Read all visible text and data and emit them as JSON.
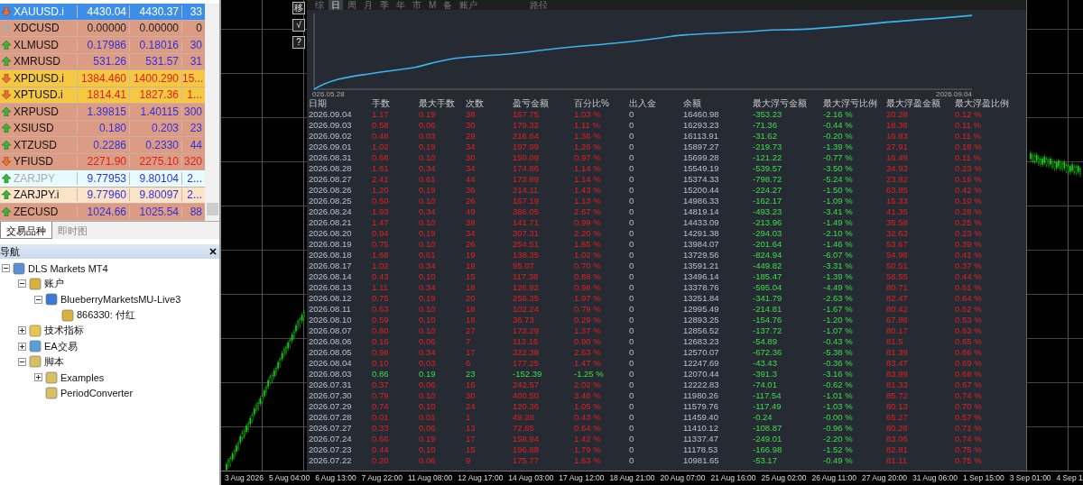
{
  "market_watch": {
    "rows": [
      {
        "symbol": "XAUUSD.i",
        "bid": "4430.04",
        "ask": "4430.37",
        "spread": "33",
        "kind": "down",
        "selected": true,
        "disabled": false
      },
      {
        "symbol": "XDCUSD",
        "bid": "0.00000",
        "ask": "0.00000",
        "spread": "0",
        "kind": "flat",
        "color": "#dc9c84",
        "selected": false,
        "disabled": false
      },
      {
        "symbol": "XLMUSD",
        "bid": "0.17986",
        "ask": "0.18016",
        "spread": "30",
        "kind": "up",
        "color": "#dc9c84",
        "selected": false,
        "disabled": false
      },
      {
        "symbol": "XMRUSD",
        "bid": "531.26",
        "ask": "531.57",
        "spread": "31",
        "kind": "up",
        "color": "#dc9c84",
        "selected": false,
        "disabled": false
      },
      {
        "symbol": "XPDUSD.i",
        "bid": "1384.460",
        "ask": "1400.290",
        "spread": "15...",
        "kind": "down",
        "color": "#f5c842",
        "selected": false,
        "disabled": false
      },
      {
        "symbol": "XPTUSD.i",
        "bid": "1814.41",
        "ask": "1827.36",
        "spread": "1...",
        "kind": "down",
        "color": "#f5c842",
        "selected": false,
        "disabled": false
      },
      {
        "symbol": "XRPUSD",
        "bid": "1.39815",
        "ask": "1.40115",
        "spread": "300",
        "kind": "up",
        "color": "#dc9c84",
        "selected": false,
        "disabled": false
      },
      {
        "symbol": "XSIUSD",
        "bid": "0.180",
        "ask": "0.203",
        "spread": "23",
        "kind": "up",
        "color": "#dc9c84",
        "selected": false,
        "disabled": false
      },
      {
        "symbol": "XTZUSD",
        "bid": "0.2286",
        "ask": "0.2330",
        "spread": "44",
        "kind": "up",
        "color": "#dc9c84",
        "selected": false,
        "disabled": false
      },
      {
        "symbol": "YFIUSD",
        "bid": "2271.90",
        "ask": "2275.10",
        "spread": "320",
        "kind": "down",
        "color": "#dc9c84",
        "selected": false,
        "disabled": false
      },
      {
        "symbol": "ZARJPY",
        "bid": "9.77953",
        "ask": "9.80104",
        "spread": "2...",
        "kind": "up",
        "color": "#e6fbfd",
        "selected": false,
        "disabled": true
      },
      {
        "symbol": "ZARJPY.i",
        "bid": "9.77960",
        "ask": "9.80097",
        "spread": "2...",
        "kind": "up",
        "color": "#fbe3c8",
        "selected": false,
        "disabled": false
      },
      {
        "symbol": "ZECUSD",
        "bid": "1024.66",
        "ask": "1025.54",
        "spread": "88",
        "kind": "up",
        "color": "#dc9c84",
        "selected": false,
        "disabled": false
      }
    ]
  },
  "bottom_tabs": [
    {
      "label": "交易品种",
      "selected": true
    },
    {
      "label": "即时图",
      "selected": false
    }
  ],
  "navigator": {
    "title": "导航",
    "tree": [
      {
        "label": "DLS Markets MT4",
        "kind": "terminal",
        "expanded": true,
        "children": [
          {
            "label": "账户",
            "kind": "accounts",
            "expanded": true,
            "children": [
              {
                "label": "BlueberryMarketsMU-Live3",
                "kind": "server",
                "expanded": true,
                "children": [
                  {
                    "label": "866330: 付红",
                    "kind": "user"
                  }
                ]
              }
            ]
          },
          {
            "label": "技术指标",
            "kind": "indicator",
            "expanded": false
          },
          {
            "label": "EA交易",
            "kind": "expert",
            "expanded": false
          },
          {
            "label": "脚本",
            "kind": "script",
            "expanded": true,
            "children": [
              {
                "label": "Examples",
                "kind": "script",
                "expanded": false
              },
              {
                "label": "PeriodConverter",
                "kind": "script"
              }
            ]
          }
        ]
      }
    ]
  },
  "report": {
    "side_buttons": [
      "移",
      "√",
      "?"
    ],
    "tabs": [
      {
        "label": "综",
        "selected": false
      },
      {
        "label": "日",
        "selected": true
      },
      {
        "label": "周",
        "selected": false
      },
      {
        "label": "月",
        "selected": false
      },
      {
        "label": "季",
        "selected": false
      },
      {
        "label": "年",
        "selected": false
      },
      {
        "label": "市",
        "selected": false
      },
      {
        "label": "M",
        "selected": false
      },
      {
        "label": "备",
        "selected": false
      },
      {
        "label": "账户",
        "selected": false
      },
      {
        "label": "路径",
        "selected": false
      }
    ],
    "equity_start": "026.05.28",
    "equity_end": "2026.09.04",
    "columns": [
      "日期",
      "手数",
      "最大手数",
      "次数",
      "盈亏金额",
      "百分比%",
      "出入金",
      "余额",
      "最大浮亏金额",
      "最大浮亏比例",
      "最大浮盈金额",
      "最大浮盈比例"
    ],
    "rows": [
      {
        "kind": "gain",
        "cells": [
          "2026.09.04",
          "1.17",
          "0.19",
          "38",
          "167.75",
          "1.03 %",
          "0",
          "16460.98",
          "-353.23",
          "-2.16 %",
          "20.28",
          "0.12 %"
        ]
      },
      {
        "kind": "gain",
        "cells": [
          "2026.09.03",
          "0.58",
          "0.06",
          "30",
          "179.32",
          "1.11 %",
          "0",
          "16293.23",
          "-71.36",
          "-0.44 %",
          "18.38",
          "0.11 %"
        ]
      },
      {
        "kind": "gain",
        "cells": [
          "2026.09.02",
          "0.48",
          "0.03",
          "29",
          "216.64",
          "1.36 %",
          "0",
          "16113.91",
          "-31.62",
          "-0.20 %",
          "16.83",
          "0.11 %"
        ]
      },
      {
        "kind": "gain",
        "cells": [
          "2026.09.01",
          "1.02",
          "0.19",
          "34",
          "197.99",
          "1.26 %",
          "0",
          "15897.27",
          "-219.73",
          "-1.39 %",
          "27.91",
          "0.18 %"
        ]
      },
      {
        "kind": "gain",
        "cells": [
          "2026.08.31",
          "0.68",
          "0.10",
          "30",
          "150.09",
          "0.97 %",
          "0",
          "15699.28",
          "-121.22",
          "-0.77 %",
          "16.49",
          "0.11 %"
        ]
      },
      {
        "kind": "gain",
        "cells": [
          "2026.08.28",
          "1.61",
          "0.34",
          "34",
          "174.86",
          "1.14 %",
          "0",
          "15549.19",
          "-539.57",
          "-3.50 %",
          "34.93",
          "0.23 %"
        ]
      },
      {
        "kind": "gain",
        "cells": [
          "2026.08.27",
          "2.41",
          "0.61",
          "44",
          "173.89",
          "1.14 %",
          "0",
          "15374.33",
          "-798.72",
          "-5.24 %",
          "23.92",
          "0.16 %"
        ]
      },
      {
        "kind": "gain",
        "cells": [
          "2026.08.26",
          "1.20",
          "0.19",
          "36",
          "214.11",
          "1.43 %",
          "0",
          "15200.44",
          "-224.27",
          "-1.50 %",
          "63.85",
          "0.42 %"
        ]
      },
      {
        "kind": "gain",
        "cells": [
          "2026.08.25",
          "0.50",
          "0.10",
          "26",
          "167.19",
          "1.13 %",
          "0",
          "14986.33",
          "-162.17",
          "-1.09 %",
          "15.33",
          "0.10 %"
        ]
      },
      {
        "kind": "gain",
        "cells": [
          "2026.08.24",
          "1.93",
          "0.34",
          "49",
          "386.05",
          "2.67 %",
          "0",
          "14819.14",
          "-493.23",
          "-3.41 %",
          "41.35",
          "0.28 %"
        ]
      },
      {
        "kind": "gain",
        "cells": [
          "2026.08.21",
          "1.47",
          "0.10",
          "39",
          "141.71",
          "0.99 %",
          "0",
          "14433.09",
          "-213.96",
          "-1.49 %",
          "35.58",
          "0.25 %"
        ]
      },
      {
        "kind": "gain",
        "cells": [
          "2026.08.20",
          "0.94",
          "0.19",
          "34",
          "307.31",
          "2.20 %",
          "0",
          "14291.38",
          "-294.03",
          "-2.10 %",
          "32.63",
          "0.23 %"
        ]
      },
      {
        "kind": "gain",
        "cells": [
          "2026.08.19",
          "0.75",
          "0.10",
          "26",
          "254.51",
          "1.85 %",
          "0",
          "13984.07",
          "-201.64",
          "-1.46 %",
          "53.67",
          "0.39 %"
        ]
      },
      {
        "kind": "gain",
        "cells": [
          "2026.08.18",
          "1.68",
          "0.61",
          "19",
          "138.35",
          "1.02 %",
          "0",
          "13729.56",
          "-824.94",
          "-6.07 %",
          "54.98",
          "0.41 %"
        ]
      },
      {
        "kind": "gain",
        "cells": [
          "2026.08.17",
          "1.02",
          "0.34",
          "19",
          "95.07",
          "0.70 %",
          "0",
          "13591.21",
          "-449.82",
          "-3.31 %",
          "50.51",
          "0.37 %"
        ]
      },
      {
        "kind": "gain",
        "cells": [
          "2026.08.14",
          "0.43",
          "0.10",
          "15",
          "117.38",
          "0.88 %",
          "0",
          "13496.14",
          "-185.47",
          "-1.39 %",
          "58.55",
          "0.44 %"
        ]
      },
      {
        "kind": "gain",
        "cells": [
          "2026.08.13",
          "1.11",
          "0.34",
          "18",
          "126.92",
          "0.96 %",
          "0",
          "13378.76",
          "-595.04",
          "-4.49 %",
          "80.71",
          "0.61 %"
        ]
      },
      {
        "kind": "gain",
        "cells": [
          "2026.08.12",
          "0.75",
          "0.19",
          "20",
          "256.35",
          "1.97 %",
          "0",
          "13251.84",
          "-341.79",
          "-2.63 %",
          "82.47",
          "0.64 %"
        ]
      },
      {
        "kind": "gain",
        "cells": [
          "2026.08.11",
          "0.63",
          "0.10",
          "18",
          "102.24",
          "0.79 %",
          "0",
          "12995.49",
          "-214.81",
          "-1.67 %",
          "80.42",
          "0.62 %"
        ]
      },
      {
        "kind": "gain",
        "cells": [
          "2026.08.10",
          "0.59",
          "0.10",
          "18",
          "36.73",
          "0.29 %",
          "0",
          "12893.25",
          "-154.76",
          "-1.20 %",
          "67.88",
          "0.53 %"
        ]
      },
      {
        "kind": "gain",
        "cells": [
          "2026.08.07",
          "0.80",
          "0.10",
          "27",
          "173.29",
          "1.37 %",
          "0",
          "12856.52",
          "-137.72",
          "-1.07 %",
          "80.17",
          "0.63 %"
        ]
      },
      {
        "kind": "gain",
        "cells": [
          "2026.08.06",
          "0.16",
          "0.06",
          "7",
          "113.16",
          "0.90 %",
          "0",
          "12683.23",
          "-54.89",
          "-0.43 %",
          "81.5",
          "0.65 %"
        ]
      },
      {
        "kind": "gain",
        "cells": [
          "2026.08.05",
          "0.96",
          "0.34",
          "17",
          "322.38",
          "2.63 %",
          "0",
          "12570.07",
          "-672.36",
          "-5.38 %",
          "81.39",
          "0.66 %"
        ]
      },
      {
        "kind": "gain",
        "cells": [
          "2026.08.04",
          "0.10",
          "0.03",
          "6",
          "177.25",
          "1.47 %",
          "0",
          "12247.69",
          "-43.43",
          "-0.36 %",
          "83.47",
          "0.69 %"
        ]
      },
      {
        "kind": "loss",
        "cells": [
          "2026.08.03",
          "0.86",
          "0.19",
          "23",
          "-152.39",
          "-1.25 %",
          "0",
          "12070.44",
          "-391.3",
          "-3.16 %",
          "83.99",
          "0.68 %"
        ]
      },
      {
        "kind": "gain",
        "cells": [
          "2026.07.31",
          "0.37",
          "0.06",
          "16",
          "242.57",
          "2.02 %",
          "0",
          "12222.83",
          "-74.01",
          "-0.62 %",
          "81.33",
          "0.67 %"
        ]
      },
      {
        "kind": "gain",
        "cells": [
          "2026.07.30",
          "0.79",
          "0.10",
          "30",
          "400.50",
          "3.46 %",
          "0",
          "11980.26",
          "-117.54",
          "-1.01 %",
          "85.72",
          "0.74 %"
        ]
      },
      {
        "kind": "gain",
        "cells": [
          "2026.07.29",
          "0.74",
          "0.10",
          "24",
          "120.36",
          "1.05 %",
          "0",
          "11579.76",
          "-117.49",
          "-1.03 %",
          "80.13",
          "0.70 %"
        ]
      },
      {
        "kind": "gain",
        "cells": [
          "2026.07.28",
          "0.01",
          "0.01",
          "1",
          "49.28",
          "0.43 %",
          "0",
          "11459.40",
          "-0.24",
          "-0.00 %",
          "65.27",
          "0.57 %"
        ]
      },
      {
        "kind": "gain",
        "cells": [
          "2026.07.27",
          "0.33",
          "0.06",
          "13",
          "72.65",
          "0.64 %",
          "0",
          "11410.12",
          "-108.87",
          "-0.96 %",
          "80.28",
          "0.71 %"
        ]
      },
      {
        "kind": "gain",
        "cells": [
          "2026.07.24",
          "0.66",
          "0.19",
          "17",
          "158.94",
          "1.42 %",
          "0",
          "11337.47",
          "-249.01",
          "-2.20 %",
          "83.06",
          "0.74 %"
        ]
      },
      {
        "kind": "gain",
        "cells": [
          "2026.07.23",
          "0.44",
          "0.10",
          "15",
          "196.88",
          "1.79 %",
          "0",
          "11178.53",
          "-166.98",
          "-1.52 %",
          "82.81",
          "0.75 %"
        ]
      },
      {
        "kind": "gain",
        "cells": [
          "2026.07.22",
          "0.20",
          "0.06",
          "9",
          "175.77",
          "1.63 %",
          "0",
          "10981.65",
          "-53.17",
          "-0.49 %",
          "81.11",
          "0.75 %"
        ]
      }
    ]
  },
  "time_axis": [
    "3 Aug 2026",
    "5 Aug 04:00",
    "6 Aug 13:00",
    "7 Aug 22:00",
    "11 Aug 08:00",
    "12 Aug 17:00",
    "14 Aug 03:00",
    "17 Aug 12:00",
    "18 Aug 21:00",
    "20 Aug 07:00",
    "21 Aug 16:00",
    "25 Aug 02:00",
    "26 Aug 11:00",
    "27 Aug 20:00",
    "31 Aug 06:00",
    "1 Sep 15:00",
    "3 Sep 01:00",
    "4 Sep 1"
  ]
}
